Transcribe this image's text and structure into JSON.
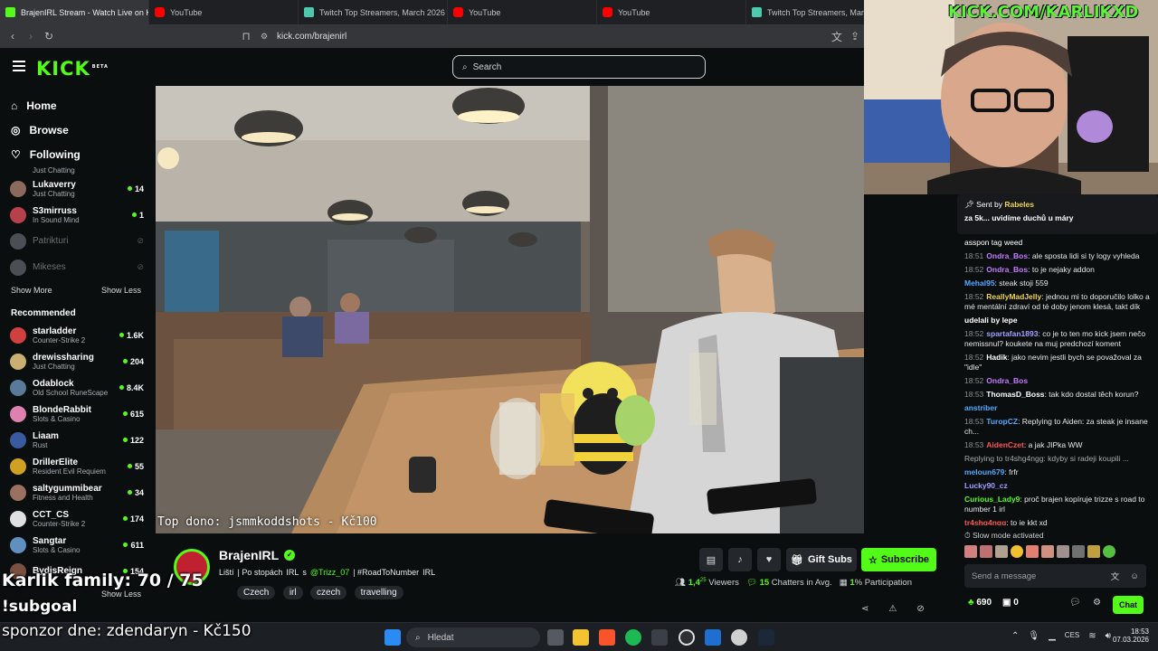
{
  "browser": {
    "tabs": [
      {
        "title": "BrajenIRL Stream - Watch Live on Kick",
        "icon": "kick-icon",
        "active": true
      },
      {
        "title": "YouTube",
        "icon": "youtube-icon",
        "active": false
      },
      {
        "title": "Twitch Top Streamers, March 2026 - Twitch",
        "icon": "twitch-tracker-icon",
        "active": false
      },
      {
        "title": "YouTube",
        "icon": "youtube-icon",
        "active": false
      },
      {
        "title": "YouTube",
        "icon": "youtube-icon",
        "active": false
      },
      {
        "title": "Twitch Top Streamers, March 2026",
        "icon": "twitch-tracker-icon",
        "active": false
      }
    ],
    "url": "kick.com/brajenirl"
  },
  "header": {
    "logo": "KICK",
    "logo_badge": "BETA",
    "search_placeholder": "Search"
  },
  "sidebar": {
    "nav": [
      {
        "label": "Home",
        "icon": "home-icon"
      },
      {
        "label": "Browse",
        "icon": "compass-icon"
      },
      {
        "label": "Following",
        "icon": "heart-icon"
      }
    ],
    "following_cut_category": "Just Chatting",
    "following": [
      {
        "name": "Lukaverry",
        "category": "Just Chatting",
        "viewers": "14",
        "color": "#8a6a5a"
      },
      {
        "name": "S3mirruss",
        "category": "In Sound Mind",
        "viewers": "1",
        "color": "#b8404a"
      },
      {
        "name": "Patrikturi",
        "category": "",
        "viewers": "",
        "color": "#4a4f55",
        "offline": true
      },
      {
        "name": "Mikeses",
        "category": "",
        "viewers": "",
        "color": "#4a4f55",
        "offline": true
      }
    ],
    "show_more": "Show More",
    "show_less": "Show Less",
    "recommended_title": "Recommended",
    "recommended": [
      {
        "name": "starladder",
        "category": "Counter-Strike 2",
        "viewers": "1.6K",
        "color": "#d04040"
      },
      {
        "name": "drewissharing",
        "category": "Just Chatting",
        "viewers": "204",
        "color": "#c8b070"
      },
      {
        "name": "Odablock",
        "category": "Old School RuneScape",
        "viewers": "8.4K",
        "color": "#5a7a9a"
      },
      {
        "name": "BlondeRabbit",
        "category": "Slots & Casino",
        "viewers": "615",
        "color": "#e080b0"
      },
      {
        "name": "Liaam",
        "category": "Rust",
        "viewers": "122",
        "color": "#3a5aa0"
      },
      {
        "name": "DrillerElite",
        "category": "Resident Evil Requiem",
        "viewers": "55",
        "color": "#d0a020"
      },
      {
        "name": "saltygummibear",
        "category": "Fitness and Health",
        "viewers": "34",
        "color": "#9a7060"
      },
      {
        "name": "CCT_CS",
        "category": "Counter-Strike 2",
        "viewers": "174",
        "color": "#e0e0e0"
      },
      {
        "name": "Sangtar",
        "category": "Slots & Casino",
        "viewers": "611",
        "color": "#6090c0"
      },
      {
        "name": "BydisReign",
        "category": "",
        "viewers": "154",
        "color": "#7a5040"
      }
    ],
    "show_less_bottom": "Show Less"
  },
  "video": {
    "top_donation": "Top dono: jsmmkoddshots - Kč100"
  },
  "stream": {
    "streamer": "BrajenIRL",
    "title_parts": [
      "Liští",
      "| Po stopách",
      "IRL",
      "s",
      "@Trizz_07",
      "| #RoadToNumber",
      "IRL"
    ],
    "tags": [
      "Czech",
      "irl",
      "czech",
      "travelling"
    ],
    "viewers": "1,4",
    "viewers_sup": "25",
    "viewers_label": "Viewers",
    "chatters": "15",
    "chatters_label": "Chatters in Avg.",
    "participation": "1",
    "participation_label": "% Participation",
    "gift_subs_label": "Gift Subs",
    "subscribe_label": "Subscribe"
  },
  "overlays": {
    "cam_link": "KICK.COM/KARLIKXD",
    "family_goal": "Karlik family: 70 / 75",
    "subgoal": "!subgoal",
    "sponsor": "sponzor dne: zdendaryn - Kč150"
  },
  "chat": {
    "pinned_prefix": "Sent by",
    "pinned_user": "Rabeles",
    "pinned_text": "za 5k... uvidíme duchů u máry",
    "messages": [
      {
        "time": "",
        "user": "",
        "color": "#ffffff",
        "text": "asspon tag weed"
      },
      {
        "time": "18:51",
        "user": "Ondra_Bos",
        "color": "#c07cff",
        "text": "ale sposta lidi si ty logy vyhleda"
      },
      {
        "time": "18:52",
        "user": "Ondra_Bos",
        "color": "#c07cff",
        "text": "to je nejaky addon"
      },
      {
        "time": "",
        "user": "Mehal95",
        "color": "#53a8ff",
        "text": "steak stoji 559"
      },
      {
        "time": "18:52",
        "user": "ReallyMadJelly",
        "color": "#f2d34f",
        "text": "jednou mi to doporučilo lolko a mé mentální zdraví od té doby jenom klesá, takt dík"
      },
      {
        "time": "",
        "user": "udelali by lepe",
        "color": "#ffffff",
        "text": ""
      },
      {
        "time": "18:52",
        "user": "spartafan1893",
        "color": "#a0a0ff",
        "text": "co je to ten mo kick jsem nečo nemissnul? koukete na muj predchozí koment"
      },
      {
        "time": "18:52",
        "user": "Hadik",
        "color": "#ffffff",
        "text": "jako nevim jestli bych se považoval za \"idle\""
      },
      {
        "time": "18:52",
        "user": "Ondra_Bos",
        "color": "#c07cff",
        "text": ""
      },
      {
        "time": "18:53",
        "user": "ThomasD_Boss",
        "color": "#ffffff",
        "text": "tak kdo dostal těch korun?"
      },
      {
        "time": "",
        "user": "anstriber",
        "color": "#53a8ff",
        "text": ""
      },
      {
        "time": "18:53",
        "user": "TuropCZ",
        "color": "#53a8ff",
        "text": "Replying to Aiden: za steak je insane ch..."
      },
      {
        "time": "18:53",
        "user": "AidenCzet",
        "color": "#ff5555",
        "text": "a jak JIPka WW"
      },
      {
        "time": "",
        "user": "",
        "color": "#aaaaaa",
        "text": "Replying to tr4shg4ngg: kdyby si radeji koupili ..."
      },
      {
        "time": "",
        "user": "meloun679",
        "color": "#53a8ff",
        "text": "frfr"
      },
      {
        "time": "",
        "user": "Lucky90_cz",
        "color": "#a0a0ff",
        "text": ""
      },
      {
        "time": "",
        "user": "Curious_Lady9",
        "color": "#53fc18",
        "text": "proč brajen kopíruje trizze s road to number 1 irl"
      },
      {
        "time": "",
        "user": "tr4shg4ngg",
        "color": "#ff5555",
        "text": "to je kkt xd"
      }
    ],
    "slow_mode": "Slow mode activated",
    "input_placeholder": "Send a message",
    "points": "690",
    "zero": "0",
    "chat_button": "Chat"
  },
  "taskbar": {
    "search_placeholder": "Hledat",
    "lang": "CES",
    "time": "18:53",
    "date": "07.03.2026"
  }
}
